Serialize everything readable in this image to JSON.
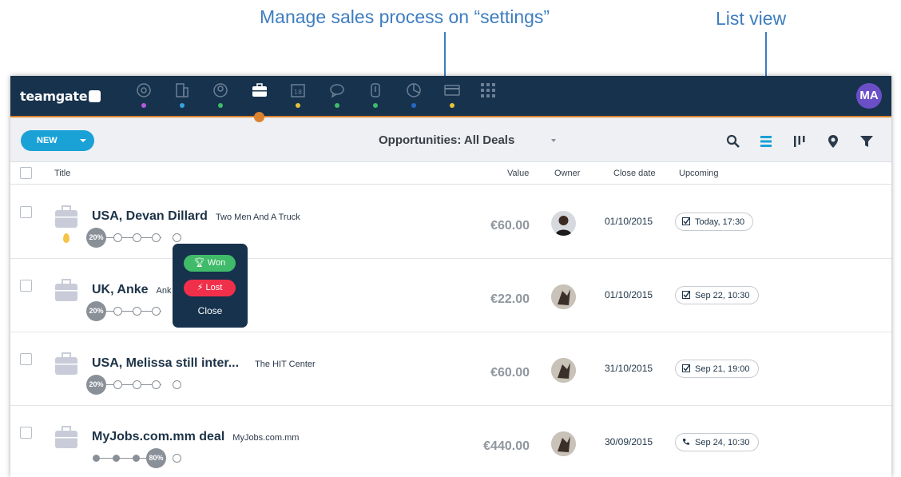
{
  "annotations": {
    "settings": "Manage sales process on “settings”",
    "list_view": "List view"
  },
  "app": {
    "logo": "teamgate",
    "user_initials": "MA",
    "user_avatar_color": "#6b4fc7",
    "topbar_color": "#17324d",
    "accent_color": "#d9832f"
  },
  "nav": {
    "items": [
      {
        "icon": "target-icon",
        "dot_color": "#b65ad9"
      },
      {
        "icon": "building-icon",
        "dot_color": "#3aa0e0"
      },
      {
        "icon": "contact-icon",
        "dot_color": "#3fbb69"
      },
      {
        "icon": "briefcase-icon",
        "dot_color": "",
        "active": true
      },
      {
        "icon": "calendar-icon",
        "dot_color": "#e3c33a"
      },
      {
        "icon": "chat-icon",
        "dot_color": "#3fbb69"
      },
      {
        "icon": "attachment-icon",
        "dot_color": "#3fbb69"
      },
      {
        "icon": "pie-chart-icon",
        "dot_color": "#2569c4"
      },
      {
        "icon": "card-icon",
        "dot_color": "#e3c33a"
      },
      {
        "icon": "apps-grid-icon",
        "dot_color": ""
      }
    ]
  },
  "toolbar": {
    "new_label": "NEW",
    "view_title": "Opportunities: All Deals",
    "tools": [
      "search-icon",
      "list-view-icon",
      "pipeline-view-icon",
      "map-pin-icon",
      "filter-icon"
    ]
  },
  "table": {
    "headers": {
      "title": "Title",
      "value": "Value",
      "owner": "Owner",
      "close_date": "Close date",
      "upcoming": "Upcoming"
    },
    "rows": [
      {
        "title": "USA, Devan Dillard",
        "org": "Two Men And A Truck",
        "value": "€60.00",
        "close_date": "01/10/2015",
        "upcoming": "Today, 17:30",
        "upcoming_icon": "task-check-icon",
        "stage_percent": "20%",
        "hot": true
      },
      {
        "title": "UK, Anke",
        "org": "Ank",
        "value": "€22.00",
        "close_date": "01/10/2015",
        "upcoming": "Sep 22, 10:30",
        "upcoming_icon": "task-check-icon",
        "stage_percent": "20%",
        "hot": false
      },
      {
        "title": "USA, Melissa still inter...",
        "org": "The HIT Center",
        "value": "€60.00",
        "close_date": "31/10/2015",
        "upcoming": "Sep 21, 19:00",
        "upcoming_icon": "task-check-icon",
        "stage_percent": "20%",
        "hot": false
      },
      {
        "title": "MyJobs.com.mm deal",
        "org": "MyJobs.com.mm",
        "value": "€440.00",
        "close_date": "30/09/2015",
        "upcoming": "Sep 24, 10:30",
        "upcoming_icon": "phone-icon",
        "stage_percent": "80%",
        "hot": false
      }
    ]
  },
  "popup": {
    "won": "Won",
    "lost": "Lost",
    "close": "Close"
  }
}
